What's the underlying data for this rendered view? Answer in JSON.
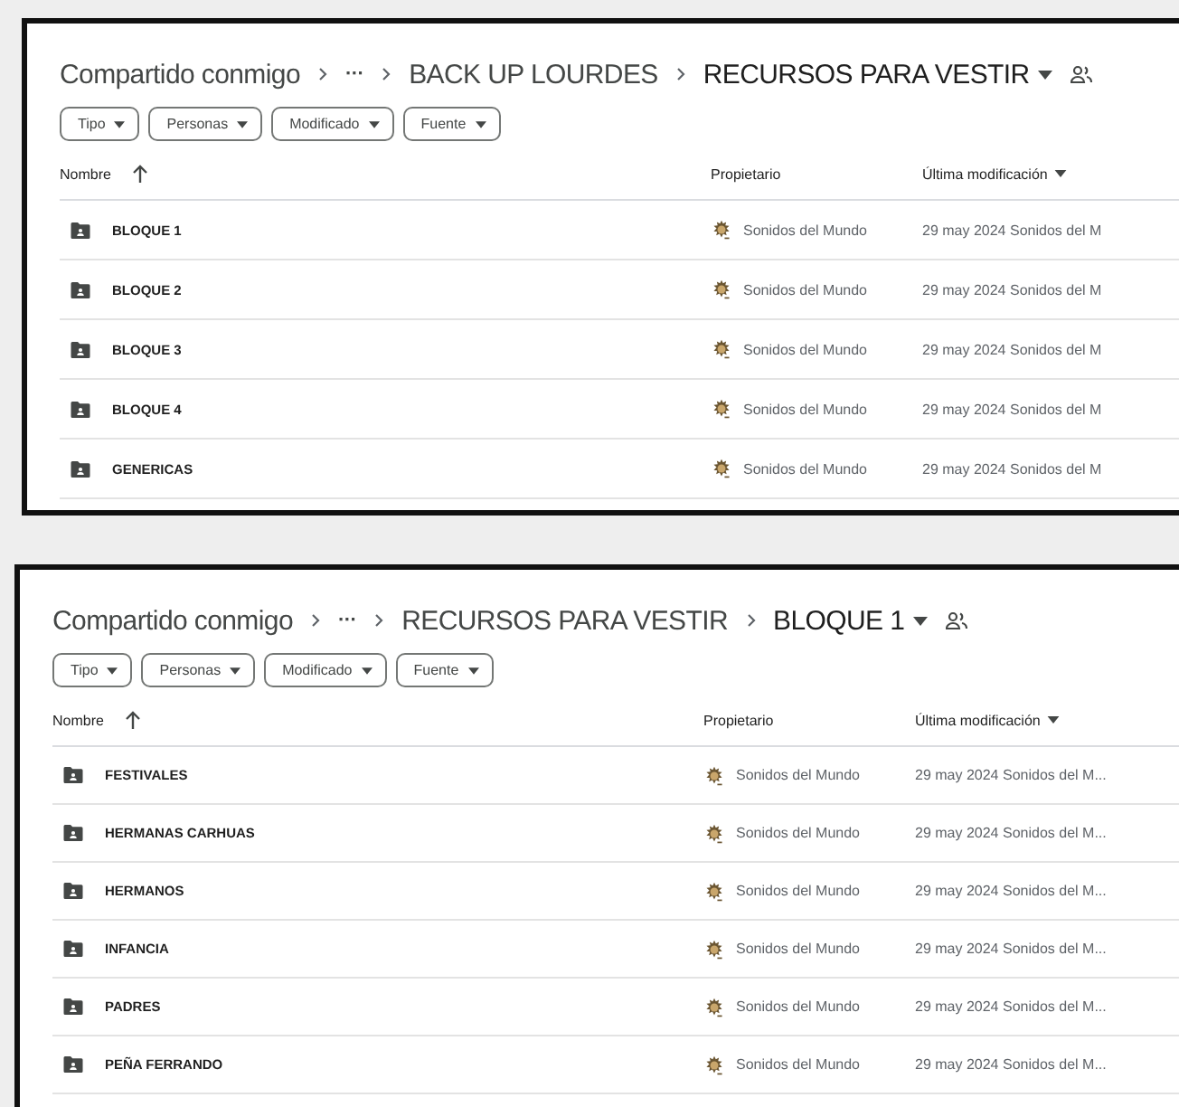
{
  "panels": [
    {
      "breadcrumb": [
        {
          "label": "Compartido conmigo",
          "kind": "root"
        },
        {
          "label": "···",
          "kind": "more"
        },
        {
          "label": "BACK UP LOURDES",
          "kind": "folder"
        },
        {
          "label": "RECURSOS PARA VESTIR",
          "kind": "current"
        }
      ],
      "filters": [
        "Tipo",
        "Personas",
        "Modificado",
        "Fuente"
      ],
      "columns": {
        "name": "Nombre",
        "owner": "Propietario",
        "modified": "Última modificación"
      },
      "rows": [
        {
          "name": "BLOQUE 1",
          "owner": "Sonidos del Mundo",
          "date": "29 may 2024",
          "modifier": "Sonidos del M"
        },
        {
          "name": "BLOQUE 2",
          "owner": "Sonidos del Mundo",
          "date": "29 may 2024",
          "modifier": "Sonidos del M"
        },
        {
          "name": "BLOQUE 3",
          "owner": "Sonidos del Mundo",
          "date": "29 may 2024",
          "modifier": "Sonidos del M"
        },
        {
          "name": "BLOQUE 4",
          "owner": "Sonidos del Mundo",
          "date": "29 may 2024",
          "modifier": "Sonidos del M"
        },
        {
          "name": "GENERICAS",
          "owner": "Sonidos del Mundo",
          "date": "29 may 2024",
          "modifier": "Sonidos del M"
        }
      ]
    },
    {
      "breadcrumb": [
        {
          "label": "Compartido conmigo",
          "kind": "root"
        },
        {
          "label": "···",
          "kind": "more"
        },
        {
          "label": "RECURSOS PARA VESTIR",
          "kind": "folder"
        },
        {
          "label": "BLOQUE 1",
          "kind": "current"
        }
      ],
      "filters": [
        "Tipo",
        "Personas",
        "Modificado",
        "Fuente"
      ],
      "columns": {
        "name": "Nombre",
        "owner": "Propietario",
        "modified": "Última modificación"
      },
      "rows": [
        {
          "name": "FESTIVALES",
          "owner": "Sonidos del Mundo",
          "date": "29 may 2024",
          "modifier": "Sonidos del M..."
        },
        {
          "name": "HERMANAS CARHUAS",
          "owner": "Sonidos del Mundo",
          "date": "29 may 2024",
          "modifier": "Sonidos del M..."
        },
        {
          "name": "HERMANOS",
          "owner": "Sonidos del Mundo",
          "date": "29 may 2024",
          "modifier": "Sonidos del M..."
        },
        {
          "name": "INFANCIA",
          "owner": "Sonidos del Mundo",
          "date": "29 may 2024",
          "modifier": "Sonidos del M..."
        },
        {
          "name": "PADRES",
          "owner": "Sonidos del Mundo",
          "date": "29 may 2024",
          "modifier": "Sonidos del M..."
        },
        {
          "name": "PEÑA FERRANDO",
          "owner": "Sonidos del Mundo",
          "date": "29 may 2024",
          "modifier": "Sonidos del M..."
        }
      ]
    }
  ]
}
